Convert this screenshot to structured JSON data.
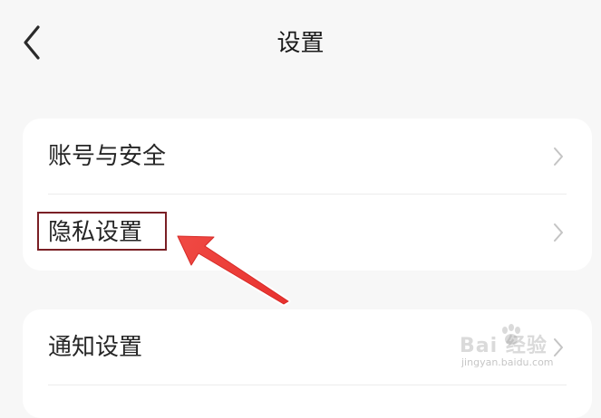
{
  "header": {
    "title": "设置",
    "back_icon": "chevron-left-icon"
  },
  "settings": {
    "groups": [
      {
        "items": [
          {
            "label": "账号与安全",
            "icon": "chevron-right-icon"
          },
          {
            "label": "隐私设置",
            "icon": "chevron-right-icon",
            "highlighted": true
          }
        ]
      },
      {
        "items": [
          {
            "label": "通知设置",
            "icon": "chevron-right-icon"
          }
        ]
      }
    ]
  },
  "annotation": {
    "highlight_color": "#7a1f25",
    "arrow_color": "#e8322f",
    "arrow_points_to": "隐私设置"
  },
  "watermark": {
    "brand": "Bai  经验",
    "url": "jingyan.baidu.com"
  },
  "colors": {
    "background": "#f7f7f7",
    "card": "#ffffff",
    "text": "#262626",
    "chevron": "#c4c4c4"
  }
}
